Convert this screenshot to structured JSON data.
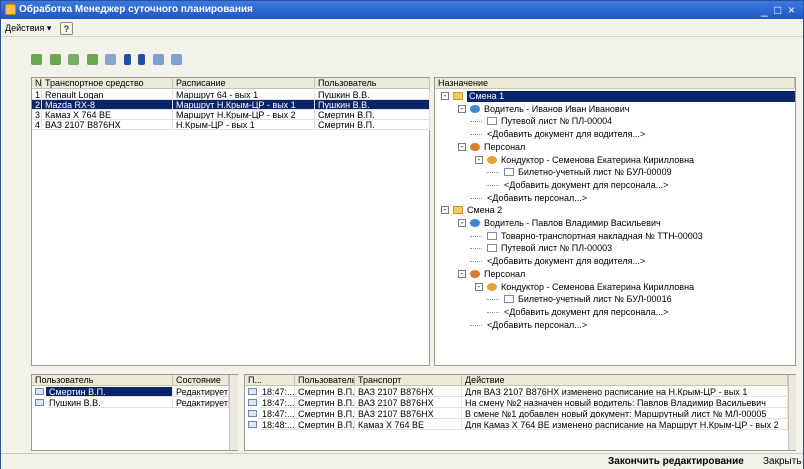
{
  "window": {
    "title": "Обработка  Менеджер суточного планирования",
    "min": "_",
    "max": "□",
    "close": "×"
  },
  "menu": {
    "actions": "Действия ▾",
    "help": "?"
  },
  "toolbar": {
    "icons": [
      "add-icon",
      "copy-icon",
      "delete-icon",
      "edit-icon",
      "save-icon",
      "up-icon",
      "down-icon",
      "sort-icon",
      "filter-icon"
    ]
  },
  "transport": {
    "headers": [
      "N",
      "Транспортное средство",
      "Расписание",
      "Пользователь"
    ],
    "rows": [
      [
        "1",
        "Renault Logan",
        "Маршрут 64 - вых 1",
        "Пушкин В.В."
      ],
      [
        "2",
        "Mazda RX-8",
        "Маршрут Н.Крым-ЦР - вых 1",
        "Пушкин В.В."
      ],
      [
        "3",
        "Камаз Х 764 ВЕ",
        "Маршрут Н.Крым-ЦР - вых 2",
        "Смертин В.П."
      ],
      [
        "4",
        "ВАЗ 2107 В876НХ",
        "Н.Крым-ЦР - вых 1",
        "Смертин В.П."
      ]
    ],
    "selected": 1
  },
  "assignment": {
    "header": "Назначение",
    "nodes": [
      {
        "text": "Смена 1",
        "level": 0,
        "icon": "folder",
        "exp": "-",
        "selected": true
      },
      {
        "text": "Водитель - Иванов Иван Иванович",
        "level": 1,
        "icon": "driver",
        "exp": "-"
      },
      {
        "text": "Путевой лист № ПЛ-00004",
        "level": 2,
        "icon": "doc"
      },
      {
        "text": "<Добавить документ для водителя...>",
        "level": 2,
        "icon": ""
      },
      {
        "text": "Персонал",
        "level": 1,
        "icon": "persons",
        "exp": "-"
      },
      {
        "text": "Кондуктор - Семенова Екатерина Кирилловна",
        "level": 2,
        "icon": "person",
        "exp": "-"
      },
      {
        "text": "Билетно-учетный лист № БУЛ-00009",
        "level": 3,
        "icon": "doc"
      },
      {
        "text": "<Добавить документ для персонала...>",
        "level": 3,
        "icon": ""
      },
      {
        "text": "<Добавить персонал...>",
        "level": 2,
        "icon": ""
      },
      {
        "text": "Смена 2",
        "level": 0,
        "icon": "folder",
        "exp": "-"
      },
      {
        "text": "Водитель - Павлов Владимир Васильевич",
        "level": 1,
        "icon": "driver",
        "exp": "-"
      },
      {
        "text": "Товарно-транспортная накладная № ТТН-00003",
        "level": 2,
        "icon": "doc"
      },
      {
        "text": "Путевой лист № ПЛ-00003",
        "level": 2,
        "icon": "doc"
      },
      {
        "text": "<Добавить документ для водителя...>",
        "level": 2,
        "icon": ""
      },
      {
        "text": "Персонал",
        "level": 1,
        "icon": "persons",
        "exp": "-"
      },
      {
        "text": "Кондуктор - Семенова Екатерина Кирилловна",
        "level": 2,
        "icon": "person",
        "exp": "-"
      },
      {
        "text": "Билетно-учетный лист № БУЛ-00016",
        "level": 3,
        "icon": "doc"
      },
      {
        "text": "<Добавить документ для персонала...>",
        "level": 3,
        "icon": ""
      },
      {
        "text": "<Добавить персонал...>",
        "level": 2,
        "icon": ""
      }
    ]
  },
  "users": {
    "headers": [
      "Пользователь",
      "Состояние"
    ],
    "rows": [
      [
        "Смертин В.П.",
        "Редактирует"
      ],
      [
        "Пушкин В.В.",
        "Редактирует"
      ]
    ]
  },
  "log": {
    "headers": [
      "П...",
      "Пользователь",
      "Транспорт",
      "Действие"
    ],
    "rows": [
      [
        "18:47:...",
        "Смертин В.П.",
        "ВАЗ 2107 В876НХ",
        "Для ВАЗ 2107 В876НХ изменено расписание на Н.Крым-ЦР - вых 1"
      ],
      [
        "18:47:...",
        "Смертин В.П.",
        "ВАЗ 2107 В876НХ",
        "На смену №2 назначен новый водитель: Павлов Владимир Васильевич"
      ],
      [
        "18:47:...",
        "Смертин В.П.",
        "ВАЗ 2107 В876НХ",
        "В смене №1 добавлен новый документ: Маршрутный лист № МЛ-00005"
      ],
      [
        "18:48:...",
        "Смертин В.П.",
        "Камаз Х 764 ВЕ",
        "Для Камаз Х 764 ВЕ изменено расписание на Маршрут Н.Крым-ЦР - вых 2"
      ]
    ]
  },
  "footer": {
    "finish": "Закончить редактирование",
    "close": "Закрыть"
  }
}
